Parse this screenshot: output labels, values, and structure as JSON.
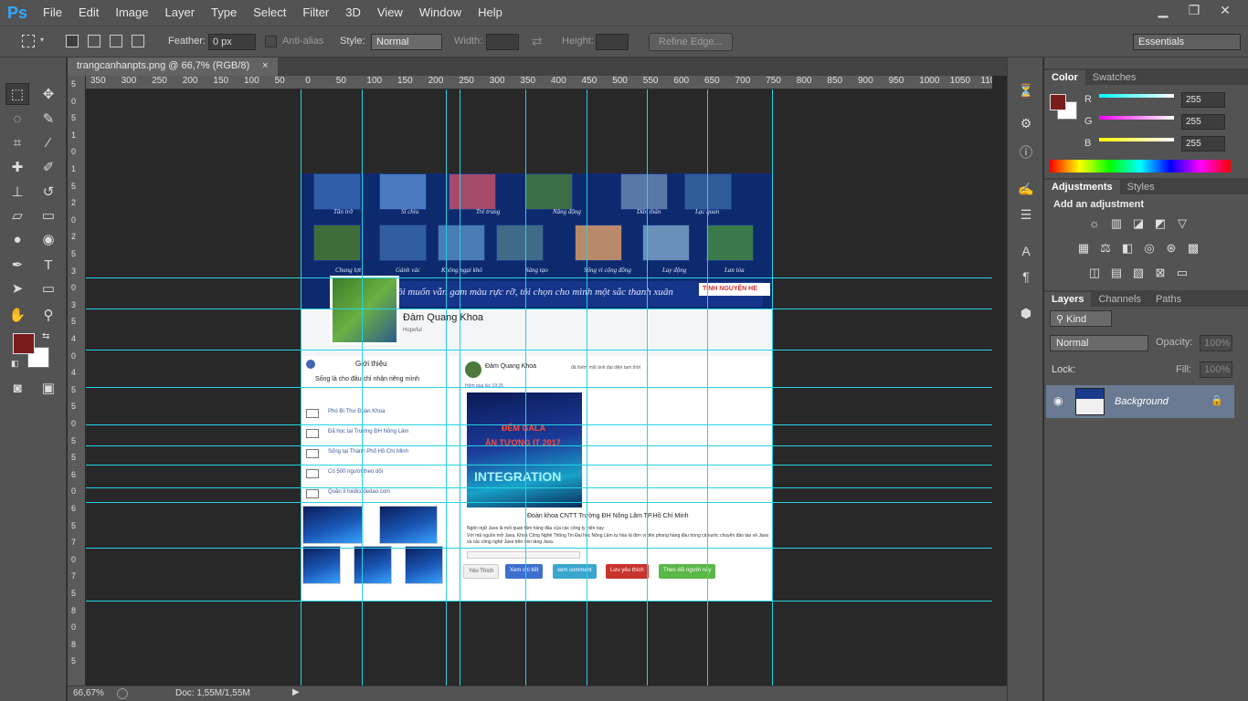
{
  "app": {
    "logo": "Ps"
  },
  "menu": [
    "File",
    "Edit",
    "Image",
    "Layer",
    "Type",
    "Select",
    "Filter",
    "3D",
    "View",
    "Window",
    "Help"
  ],
  "window_controls": {
    "minimize": "▁",
    "restore": "❐",
    "close": "✕"
  },
  "options": {
    "feather_label": "Feather:",
    "feather_value": "0 px",
    "antialias_label": "Anti-alias",
    "style_label": "Style:",
    "style_value": "Normal",
    "width_label": "Width:",
    "height_label": "Height:",
    "refine_edge": "Refine Edge...",
    "workspace": "Essentials"
  },
  "document": {
    "tab_title": "trangcanhanpts.png @ 66,7% (RGB/8)",
    "close": "×"
  },
  "ruler_top": [
    "350",
    "300",
    "250",
    "200",
    "150",
    "100",
    "50",
    "0",
    "50",
    "100",
    "150",
    "200",
    "250",
    "300",
    "350",
    "400",
    "450",
    "500",
    "550",
    "600",
    "650",
    "700",
    "750",
    "800",
    "850",
    "900",
    "950",
    "1000",
    "1050",
    "1100"
  ],
  "ruler_left": [
    "5",
    "0",
    "5",
    "1",
    "0",
    "1",
    "5",
    "2",
    "0",
    "2",
    "5",
    "3",
    "0",
    "3",
    "5",
    "4",
    "0",
    "4",
    "5",
    "5",
    "0",
    "5",
    "5",
    "6",
    "0",
    "6",
    "5",
    "7",
    "0",
    "7",
    "5",
    "8",
    "0",
    "8",
    "5"
  ],
  "page": {
    "captions_row1": [
      "Tân trở",
      "Sĩ chìu",
      "Trẻ trung",
      "Năng động",
      "Dấn thân",
      "Lạc quan"
    ],
    "captions_row2": [
      "Chung lợt",
      "Gánh vác",
      "Không ngại khó",
      "Sáng tạo",
      "Sống vì cộng đồng",
      "Lay động",
      "Lan tỏa"
    ],
    "slogan": "Tôi muốn vẫn gam màu rực rỡ, tôi chọn cho mình một sắc thanh xuân",
    "tnv_label": "TÌNH NGUYỆN HE",
    "profile_name": "Đàm Quang Khoa",
    "profile_sub": "Hopeful",
    "intro_title": "Giới thiệu",
    "intro_quote": "Sống là cho đâu chỉ nhận riêng mình",
    "intro_items": [
      {
        "icon": "briefcase-icon",
        "text": "Phó Bí Thư Đoàn Khoa"
      },
      {
        "icon": "graduation-icon",
        "text": "Đã học tại Trường ĐH Nông Lâm"
      },
      {
        "icon": "home-icon",
        "text": "Sống tại Thành Phố Hồ Chí Minh"
      },
      {
        "icon": "follower-icon",
        "text": "Có 500 người theo dõi"
      },
      {
        "icon": "flag-icon",
        "text": "Quản lí toidicodedao.com"
      }
    ],
    "post_author": "Đàm Quang Khoa",
    "post_action": "đã thêm một ảnh đại diện tạm thời",
    "post_time": "Hôm qua lúc 19:35",
    "poster_line1": "ĐÊM GALA",
    "poster_line2": "ẤN TƯỢNG IT 2017",
    "poster_line3": "INTEGRATION",
    "post_caption": "Đoàn khoa CNTT Trường ĐH Nông Lâm TP.Hồ Chí Minh",
    "post_line1": "Ngôn ngữ Java là mối quan tâm hàng đầu của các công ty hiện nay",
    "post_line2": "Với mã nguồn mở Java, Khoa Công Nghệ Thông Tin Đại học Nông Lâm tự hào là đơn vị tiên phong hàng đầu trong cả nước chuyên đào tạo về Java và các công nghệ Java trên nền tảng Java.",
    "buttons": [
      "Yêu Thích",
      "Xem chi tiết",
      "xem comment",
      "Lưu yêu thích",
      "Theo dõi người này"
    ]
  },
  "status": {
    "zoom": "66,67%",
    "doc": "Doc: 1,55M/1,55M"
  },
  "color_panel": {
    "tabs": [
      "Color",
      "Swatches"
    ],
    "channels": [
      {
        "label": "R",
        "value": "255",
        "color": "#00ffff"
      },
      {
        "label": "G",
        "value": "255",
        "color": "#ff00ff"
      },
      {
        "label": "B",
        "value": "255",
        "color": "#ffff00"
      }
    ],
    "foreground": "#7a1c1c",
    "background": "#ffffff"
  },
  "adjustments": {
    "tabs": [
      "Adjustments",
      "Styles"
    ],
    "title": "Add an adjustment"
  },
  "layers": {
    "tabs": [
      "Layers",
      "Channels",
      "Paths"
    ],
    "kind": "Kind",
    "blend": "Normal",
    "opacity_label": "Opacity:",
    "opacity": "100%",
    "lock_label": "Lock:",
    "fill_label": "Fill:",
    "fill": "100%",
    "layer_name": "Background"
  }
}
